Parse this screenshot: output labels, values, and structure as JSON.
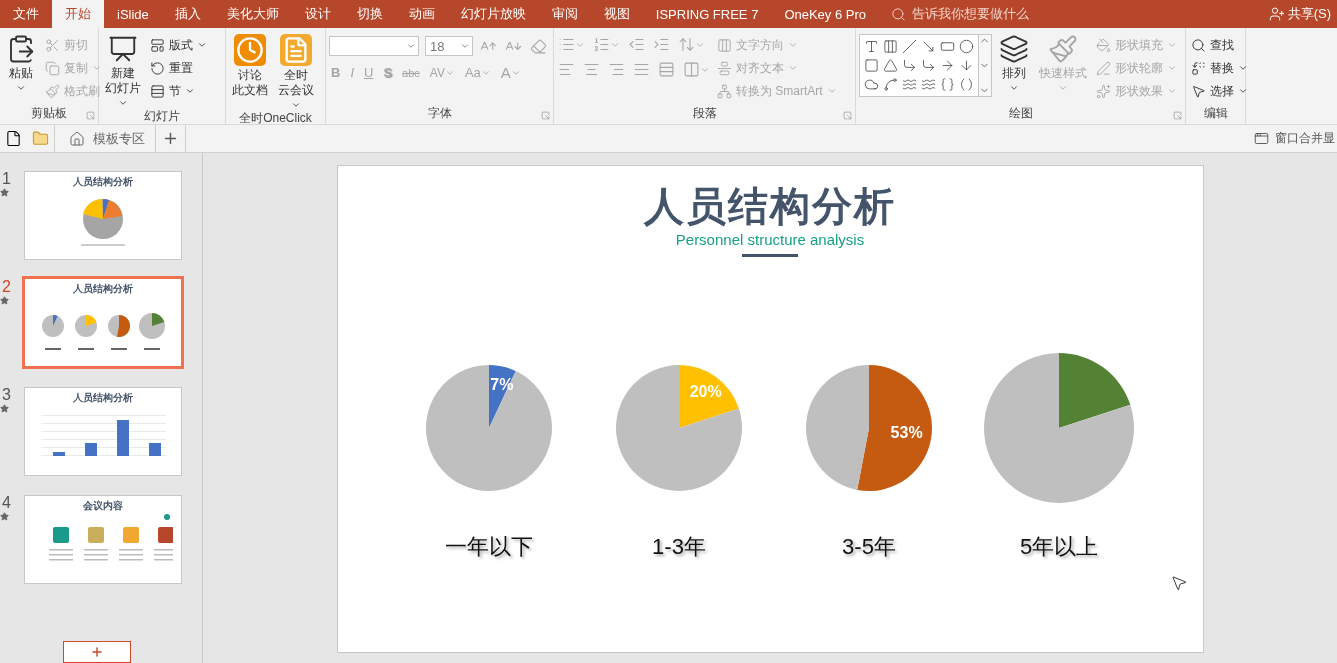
{
  "window": {
    "tabs": [
      {
        "label": "文件",
        "selected": false
      },
      {
        "label": "开始",
        "selected": true
      },
      {
        "label": "iSlide",
        "selected": false
      },
      {
        "label": "插入",
        "selected": false
      },
      {
        "label": "美化大师",
        "selected": false
      },
      {
        "label": "设计",
        "selected": false
      },
      {
        "label": "切换",
        "selected": false
      },
      {
        "label": "动画",
        "selected": false
      },
      {
        "label": "幻灯片放映",
        "selected": false
      },
      {
        "label": "审阅",
        "selected": false
      },
      {
        "label": "视图",
        "selected": false
      },
      {
        "label": "ISPRING FREE 7",
        "selected": false
      },
      {
        "label": "OneKey 6 Pro",
        "selected": false
      }
    ],
    "tell_me": {
      "placeholder": "告诉我你想要做什么"
    },
    "share": "共享(S)"
  },
  "ribbon": {
    "groups": [
      {
        "label": "剪贴板",
        "launcher": true,
        "items": [
          {
            "kind": "large",
            "lines": [
              "粘贴"
            ],
            "menu": true,
            "disabled": false
          },
          {
            "kind": "small",
            "label": "剪切",
            "menu": false,
            "disabled": true
          },
          {
            "kind": "small",
            "label": "复制",
            "menu": true,
            "disabled": true
          },
          {
            "kind": "small",
            "label": "格式刷",
            "menu": false,
            "disabled": true
          }
        ]
      },
      {
        "label": "幻灯片",
        "launcher": false,
        "items": [
          {
            "kind": "large",
            "lines": [
              "新建",
              "幻灯片"
            ],
            "menu": true,
            "disabled": false
          },
          {
            "kind": "small",
            "label": "版式",
            "menu": true,
            "disabled": false
          },
          {
            "kind": "small",
            "label": "重置",
            "menu": false,
            "disabled": false
          },
          {
            "kind": "small",
            "label": "节",
            "menu": true,
            "disabled": false
          }
        ]
      },
      {
        "label": "全时OneClick",
        "launcher": false,
        "items": [
          {
            "kind": "large",
            "lines": [
              "讨论",
              "此文档"
            ],
            "menu": false,
            "disabled": false
          },
          {
            "kind": "large",
            "lines": [
              "全时",
              "云会议"
            ],
            "menu": true,
            "disabled": false
          }
        ]
      },
      {
        "label": "字体",
        "launcher": true,
        "rows": [
          {
            "controls": [
              {
                "kind": "field",
                "menu": true,
                "disabled": false
              },
              {
                "kind": "field",
                "value": "18",
                "menu": true,
                "disabled": false
              },
              {
                "kind": "icon",
                "menu": false,
                "disabled": true
              },
              {
                "kind": "icon",
                "menu": false,
                "disabled": true
              },
              {
                "kind": "icon",
                "menu": false,
                "disabled": true
              }
            ]
          },
          {
            "controls": [
              {
                "kind": "text",
                "label": "B",
                "menu": false,
                "disabled": true
              },
              {
                "kind": "text",
                "label": "I",
                "menu": false,
                "disabled": true
              },
              {
                "kind": "text",
                "label": "U",
                "menu": false,
                "disabled": true
              },
              {
                "kind": "text",
                "label": "S",
                "menu": false,
                "disabled": true
              },
              {
                "kind": "text",
                "label": "abc",
                "menu": false,
                "disabled": true
              },
              {
                "kind": "text",
                "label": "AV",
                "menu": true,
                "disabled": true
              },
              {
                "kind": "text",
                "label": "Aa",
                "menu": true,
                "disabled": true
              },
              {
                "kind": "text",
                "label": "A",
                "menu": true,
                "disabled": true
              }
            ]
          }
        ]
      },
      {
        "label": "段落",
        "launcher": true,
        "rows": [
          {
            "controls": [
              {
                "kind": "icon",
                "menu": true,
                "disabled": true
              },
              {
                "kind": "icon",
                "menu": true,
                "disabled": true
              },
              {
                "kind": "icon",
                "menu": false,
                "disabled": true
              },
              {
                "kind": "icon",
                "menu": false,
                "disabled": true
              },
              {
                "kind": "icon",
                "menu": true,
                "disabled": true
              }
            ]
          },
          {
            "controls": [
              {
                "kind": "icon",
                "menu": false,
                "disabled": true
              },
              {
                "kind": "icon",
                "menu": false,
                "disabled": true
              },
              {
                "kind": "icon",
                "menu": false,
                "disabled": true
              },
              {
                "kind": "icon",
                "menu": false,
                "disabled": true
              },
              {
                "kind": "icon",
                "menu": false,
                "disabled": true
              },
              {
                "kind": "icon",
                "menu": true,
                "disabled": true
              }
            ]
          }
        ],
        "items": [
          {
            "kind": "small",
            "label": "文字方向",
            "menu": true,
            "disabled": true
          },
          {
            "kind": "small",
            "label": "对齐文本",
            "menu": true,
            "disabled": true
          },
          {
            "kind": "small",
            "label": "转换为 SmartArt",
            "menu": true,
            "disabled": true
          }
        ]
      },
      {
        "label": "绘图",
        "launcher": true,
        "items": [
          {
            "kind": "gallery",
            "disabled": false
          },
          {
            "kind": "large",
            "lines": [
              "排列"
            ],
            "menu": true,
            "disabled": false
          },
          {
            "kind": "large",
            "lines": [
              "快速样式"
            ],
            "menu": true,
            "disabled": true
          },
          {
            "kind": "small",
            "label": "形状填充",
            "menu": true,
            "disabled": true
          },
          {
            "kind": "small",
            "label": "形状轮廓",
            "menu": true,
            "disabled": true
          },
          {
            "kind": "small",
            "label": "形状效果",
            "menu": true,
            "disabled": true
          }
        ]
      },
      {
        "label": "编辑",
        "launcher": false,
        "items": [
          {
            "kind": "small",
            "label": "查找",
            "menu": false,
            "disabled": false
          },
          {
            "kind": "small",
            "label": "替换",
            "menu": true,
            "disabled": false
          },
          {
            "kind": "small",
            "label": "选择",
            "menu": true,
            "disabled": false
          }
        ]
      }
    ]
  },
  "quick_bar": {
    "tab": {
      "label": "模板专区"
    },
    "merge_label": "窗口合并显"
  },
  "slides_panel": {
    "slides": [
      {
        "number": "1",
        "title": "人员结构分析",
        "selected": false,
        "kind": "pie"
      },
      {
        "number": "2",
        "title": "人员结构分析",
        "selected": true,
        "kind": "pies"
      },
      {
        "number": "3",
        "title": "人员结构分析",
        "selected": false,
        "kind": "bars"
      },
      {
        "number": "4",
        "title": "会议内容",
        "selected": false,
        "kind": "icons"
      }
    ]
  },
  "slide": {
    "title": "人员结构分析",
    "subtitle": "Personnel structure analysis",
    "pies": [
      {
        "label": "一年以下",
        "color": "#4472c4",
        "chart_data": {
          "type": "pie",
          "values": [
            7,
            93
          ],
          "value_labels": [
            "7%",
            null
          ]
        }
      },
      {
        "label": "1-3年",
        "color": "#ffc000",
        "chart_data": {
          "type": "pie",
          "values": [
            20,
            80
          ],
          "value_labels": [
            "20%",
            null
          ]
        }
      },
      {
        "label": "3-5年",
        "color": "#c55a11",
        "chart_data": {
          "type": "pie",
          "values": [
            53,
            47
          ],
          "value_labels": [
            "53%",
            null
          ]
        }
      },
      {
        "label": "5年以上",
        "color": "#548235",
        "chart_data": {
          "type": "pie",
          "values": [
            20,
            80
          ]
        }
      }
    ]
  }
}
